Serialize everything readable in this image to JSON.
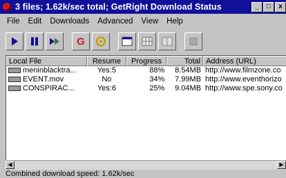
{
  "window": {
    "title": "3 files; 1.62k/sec total; GetRight Download Status",
    "controls": [
      "_",
      "□",
      "x"
    ]
  },
  "menu": [
    "File",
    "Edit",
    "Downloads",
    "Advanced",
    "View",
    "Help"
  ],
  "toolbar": {
    "icons": [
      "play-icon",
      "pause-icon",
      "skip-icon",
      "getright-g-icon",
      "target-icon",
      "window-icon",
      "grid-icon",
      "disabled-icon"
    ],
    "g_label": "G"
  },
  "columns": [
    "Local File",
    "Resume",
    "Progress",
    "Total",
    "Address (URL)"
  ],
  "rows": [
    {
      "file": "meninblacktra...",
      "resume": "Yes:5",
      "progress": "88%",
      "total": "8.54MB",
      "url": "http://www.filmzone.co"
    },
    {
      "file": "EVENT.mov",
      "resume": "No",
      "progress": "34%",
      "total": "7.99MB",
      "url": "http://www.eventhorizo"
    },
    {
      "file": "CONSPIRAC...",
      "resume": "Yes:6",
      "progress": "25%",
      "total": "9.04MB",
      "url": "http://www.spe.sony.co"
    }
  ],
  "status": "Combined download speed:  1.62k/sec",
  "colors": {
    "titlebar": "#10109a",
    "window": "#c4c4c4",
    "list_bg": "#ffffff"
  }
}
